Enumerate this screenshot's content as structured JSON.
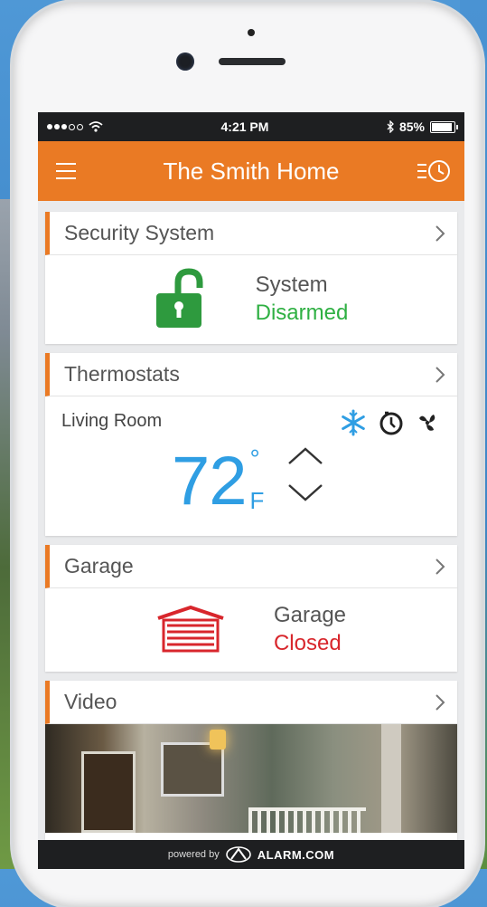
{
  "status_bar": {
    "time": "4:21 PM",
    "battery": "85%"
  },
  "header": {
    "title": "The Smith Home"
  },
  "security": {
    "title": "Security System",
    "label": "System",
    "state": "Disarmed",
    "state_color": "#2fb043"
  },
  "thermostats": {
    "title": "Thermostats",
    "room": "Living Room",
    "temperature": "72",
    "degree": "°",
    "unit": "F"
  },
  "garage": {
    "title": "Garage",
    "label": "Garage",
    "state": "Closed",
    "state_color": "#d8262c"
  },
  "video": {
    "title": "Video"
  },
  "footer": {
    "powered_by": "powered by",
    "brand": "ALARM.COM"
  },
  "colors": {
    "accent": "#ea7a24",
    "temperature": "#2f9ee3"
  }
}
